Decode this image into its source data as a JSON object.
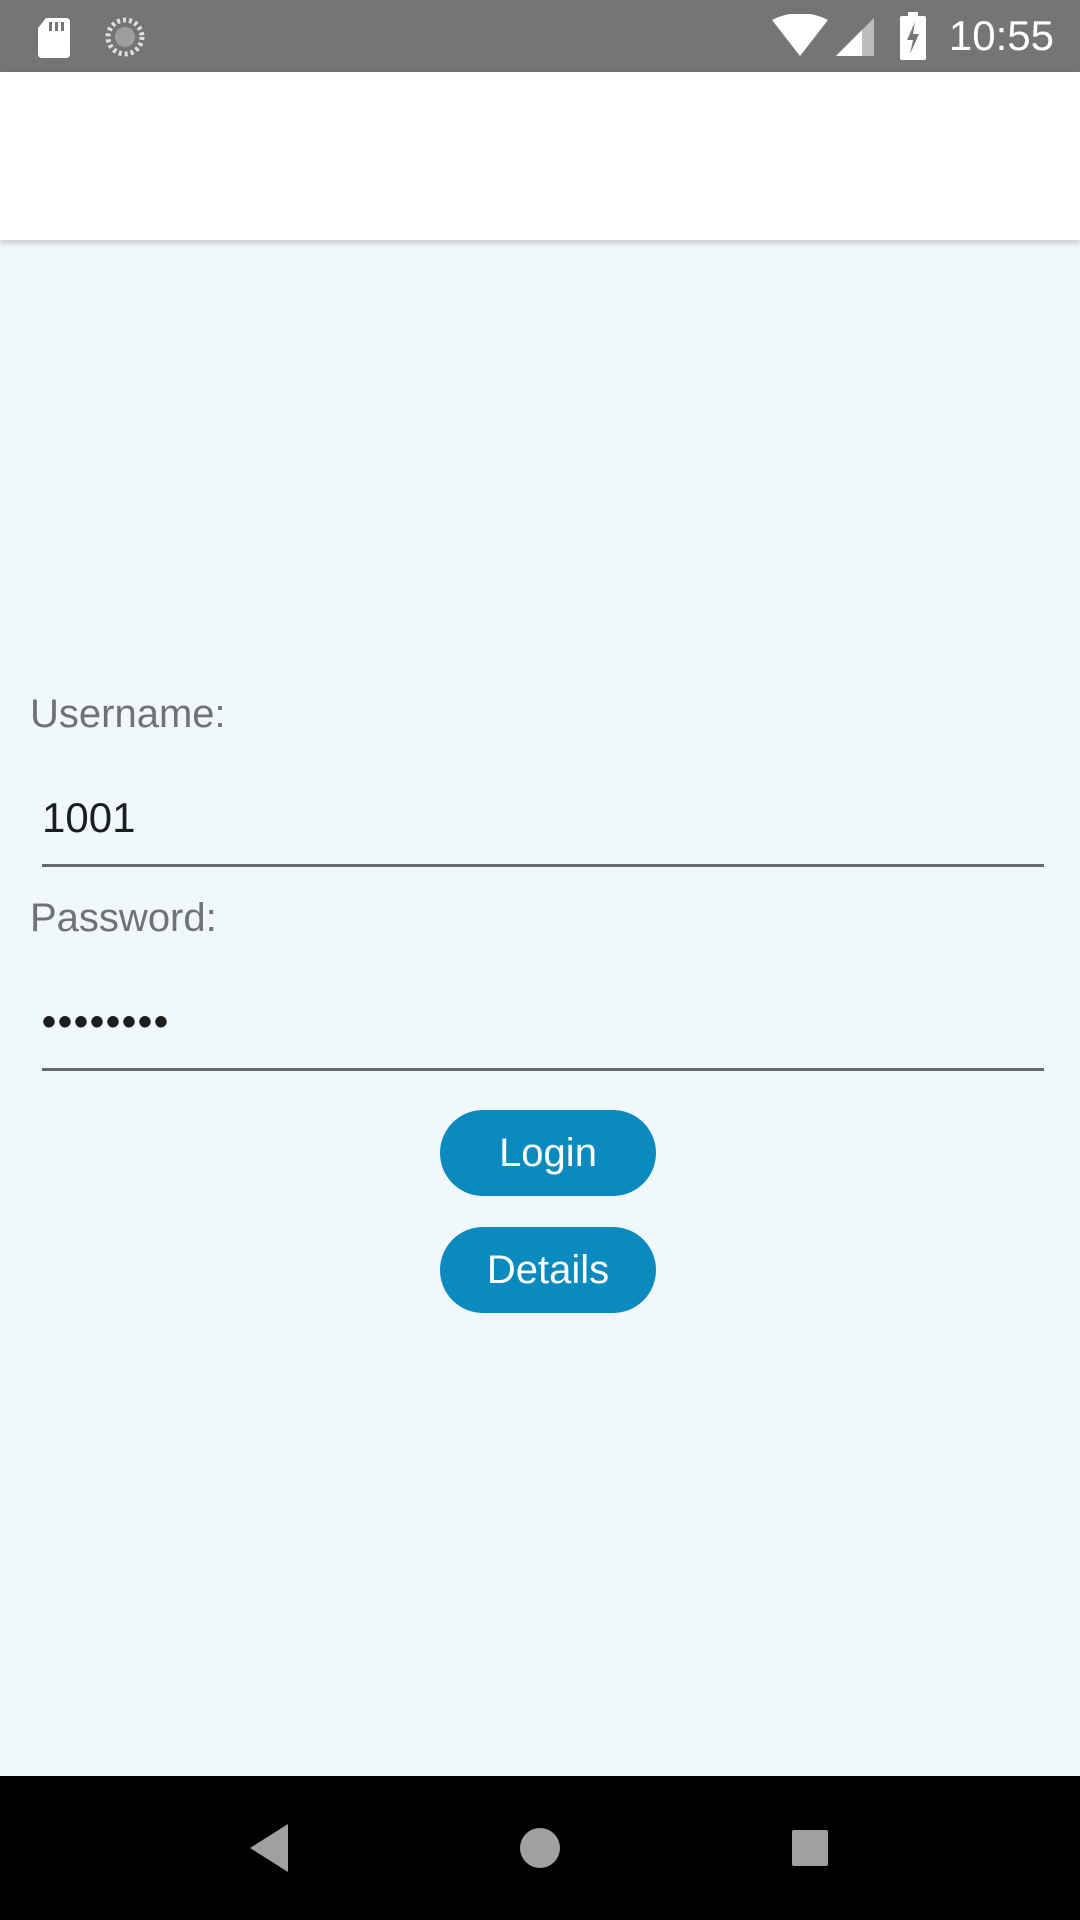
{
  "status_bar": {
    "time": "10:55",
    "icons": [
      "sd-card-icon",
      "sync-icon",
      "wifi-icon",
      "cell-signal-icon",
      "battery-charging-icon"
    ]
  },
  "form": {
    "username_label": "Username:",
    "username_value": "1001",
    "password_label": "Password:",
    "password_value": "••••••••"
  },
  "buttons": {
    "login_label": "Login",
    "details_label": "Details"
  },
  "nav_bar": {
    "icons": [
      "back-icon",
      "home-icon",
      "recents-icon"
    ]
  },
  "colors": {
    "status_bar": "#757575",
    "app_bar": "#ffffff",
    "background": "#f0f8fb",
    "button": "#0b8ac0",
    "nav_bar": "#000000"
  }
}
